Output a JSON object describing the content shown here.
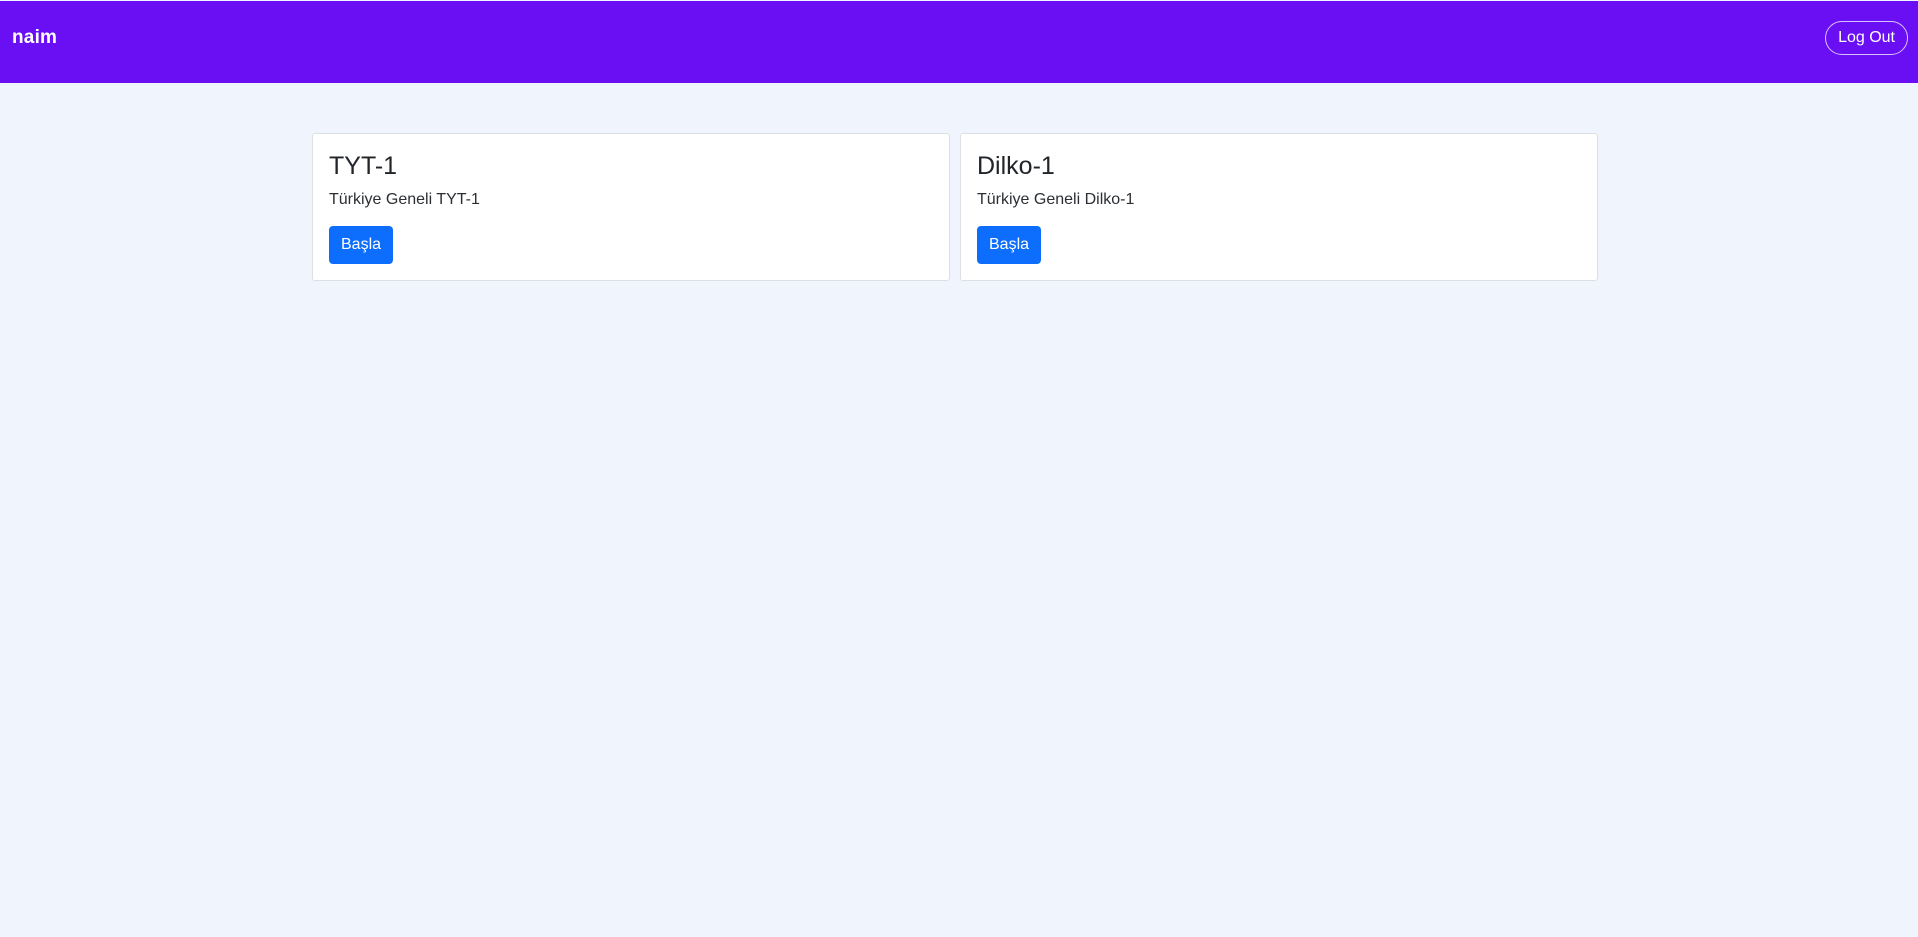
{
  "navbar": {
    "brand": "naim",
    "logout_label": "Log Out"
  },
  "cards": [
    {
      "title": "TYT-1",
      "description": "Türkiye Geneli TYT-1",
      "button_label": "Başla"
    },
    {
      "title": "Dilko-1",
      "description": "Türkiye Geneli Dilko-1",
      "button_label": "Başla"
    }
  ],
  "colors": {
    "navbar_bg": "#6a0ff4",
    "page_bg": "#f0f5fd",
    "primary_button": "#0d6efd"
  }
}
